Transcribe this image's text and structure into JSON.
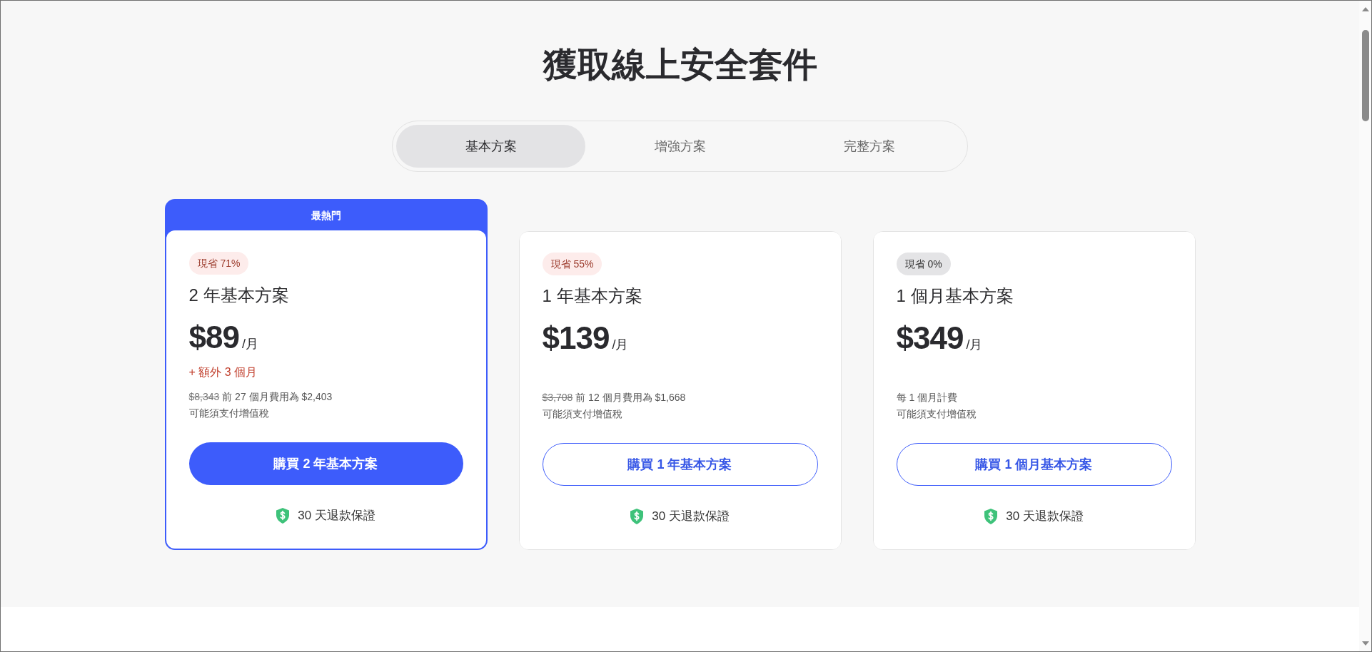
{
  "title": "獲取線上安全套件",
  "tabs": [
    {
      "label": "基本方案",
      "selected": true
    },
    {
      "label": "增強方案",
      "selected": false
    },
    {
      "label": "完整方案",
      "selected": false
    }
  ],
  "plans": [
    {
      "ribbon": "最熱門",
      "highlighted": true,
      "badge": {
        "kind": "discount",
        "text": "現省 71%"
      },
      "name": "2 年基本方案",
      "price": "$89",
      "unit": "/月",
      "bonus": "+ 額外 3 個月",
      "original_price": "$8,343",
      "billing": "前 27 個月費用為 $2,403",
      "tax_note": "可能須支付增值稅",
      "button": "購買 2 年基本方案",
      "guarantee": "30 天退款保證"
    },
    {
      "highlighted": false,
      "badge": {
        "kind": "discount",
        "text": "現省 55%"
      },
      "name": "1 年基本方案",
      "price": "$139",
      "unit": "/月",
      "original_price": "$3,708",
      "billing": "前 12 個月費用為 $1,668",
      "tax_note": "可能須支付增值稅",
      "button": "購買 1 年基本方案",
      "guarantee": "30 天退款保證"
    },
    {
      "highlighted": false,
      "badge": {
        "kind": "plain",
        "text": "現省 0%"
      },
      "name": "1 個月基本方案",
      "price": "$349",
      "unit": "/月",
      "billing": "每 1 個月計費",
      "tax_note": "可能須支付增值稅",
      "button": "購買 1 個月基本方案",
      "guarantee": "30 天退款保證"
    }
  ]
}
